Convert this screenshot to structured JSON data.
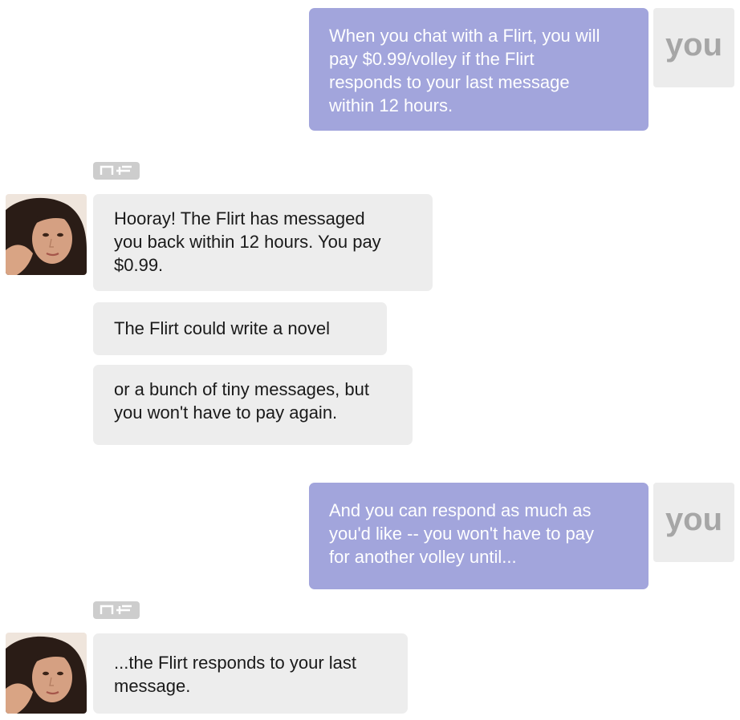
{
  "user_label": "you",
  "flirt_tag_icon": "nf-logo-icon",
  "avatar_icon": "flirt-avatar-photo",
  "colors": {
    "user_bubble": "#a2a5dc",
    "flirt_bubble": "#ededed",
    "badge": "#ececec",
    "badge_text": "#a6a6a6",
    "tag": "#cdcdcd"
  },
  "messages": [
    {
      "sender": "user",
      "text": "When you chat with a Flirt, you will\npay $0.99/volley if the Flirt\nresponds to your last message\nwithin 12 hours."
    },
    {
      "sender": "flirt",
      "text": "Hooray! The Flirt has messaged\nyou back within 12 hours. You pay\n$0.99."
    },
    {
      "sender": "flirt",
      "text": "The Flirt could write a novel"
    },
    {
      "sender": "flirt",
      "text": "or a bunch of tiny messages, but\nyou won't have to pay again."
    },
    {
      "sender": "user",
      "text": "And you can respond as much as\nyou'd like -- you won't have to pay\nfor another volley until..."
    },
    {
      "sender": "flirt",
      "text": "...the Flirt responds to your last\nmessage."
    }
  ]
}
